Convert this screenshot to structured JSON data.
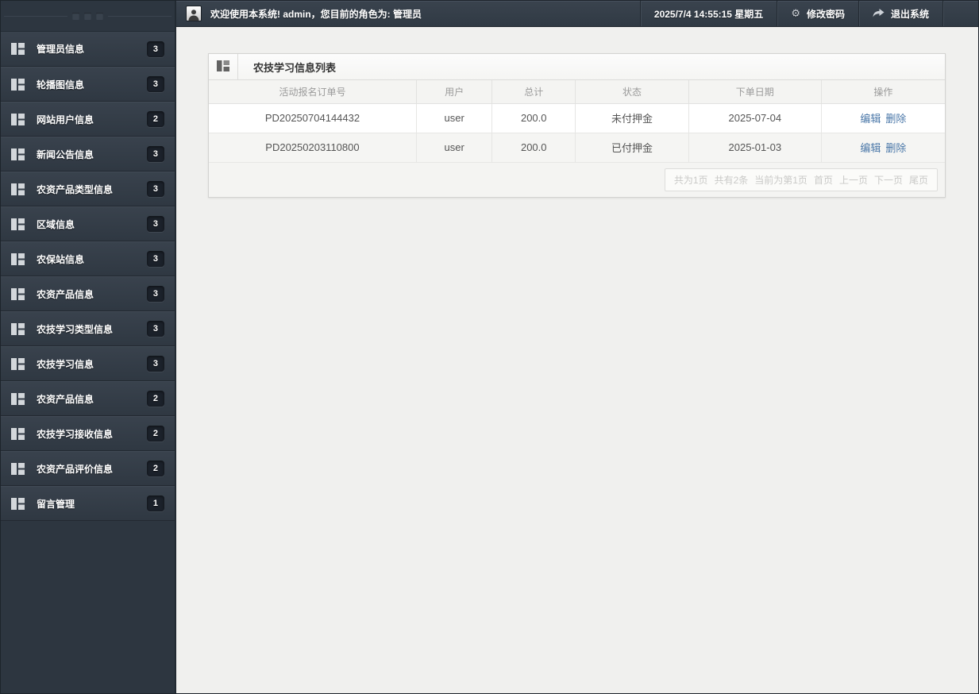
{
  "colors": {
    "sidebar_bg": "#2d3640",
    "badge_bg": "#1b212a",
    "topbar_top": "#3a434e",
    "topbar_bottom": "#303a44",
    "content_bg": "#f0f0ee",
    "link_color": "#4a77a8"
  },
  "sidebar": {
    "items": [
      {
        "label": "管理员信息",
        "badge": "3"
      },
      {
        "label": "轮播图信息",
        "badge": "3"
      },
      {
        "label": "网站用户信息",
        "badge": "2"
      },
      {
        "label": "新闻公告信息",
        "badge": "3"
      },
      {
        "label": "农资产品类型信息",
        "badge": "3"
      },
      {
        "label": "区域信息",
        "badge": "3"
      },
      {
        "label": "农保站信息",
        "badge": "3"
      },
      {
        "label": "农资产品信息",
        "badge": "3"
      },
      {
        "label": "农技学习类型信息",
        "badge": "3"
      },
      {
        "label": "农技学习信息",
        "badge": "3"
      },
      {
        "label": "农资产品信息",
        "badge": "2"
      },
      {
        "label": "农技学习接收信息",
        "badge": "2"
      },
      {
        "label": "农资产品评价信息",
        "badge": "2"
      },
      {
        "label": "留言管理",
        "badge": "1"
      }
    ]
  },
  "topbar": {
    "welcome": "欢迎使用本系统! admin，您目前的角色为: 管理员",
    "datetime": "2025/7/4 14:55:15 星期五",
    "change_password": "修改密码",
    "logout": "退出系统"
  },
  "panel": {
    "title": "农技学习信息列表",
    "table": {
      "headers": [
        "活动报名订单号",
        "用户",
        "总计",
        "状态",
        "下单日期",
        "操作"
      ],
      "rows": [
        {
          "order_no": "PD20250704144432",
          "user": "user",
          "total": "200.0",
          "status": "未付押金",
          "date": "2025-07-04",
          "edit": "编辑",
          "delete": "删除"
        },
        {
          "order_no": "PD20250203110800",
          "user": "user",
          "total": "200.0",
          "status": "已付押金",
          "date": "2025-01-03",
          "edit": "编辑",
          "delete": "删除"
        }
      ]
    },
    "pagination": {
      "total_pages": "共为1页",
      "total_items": "共有2条",
      "current": "当前为第1页",
      "first": "首页",
      "prev": "上一页",
      "next": "下一页",
      "last": "尾页"
    }
  }
}
